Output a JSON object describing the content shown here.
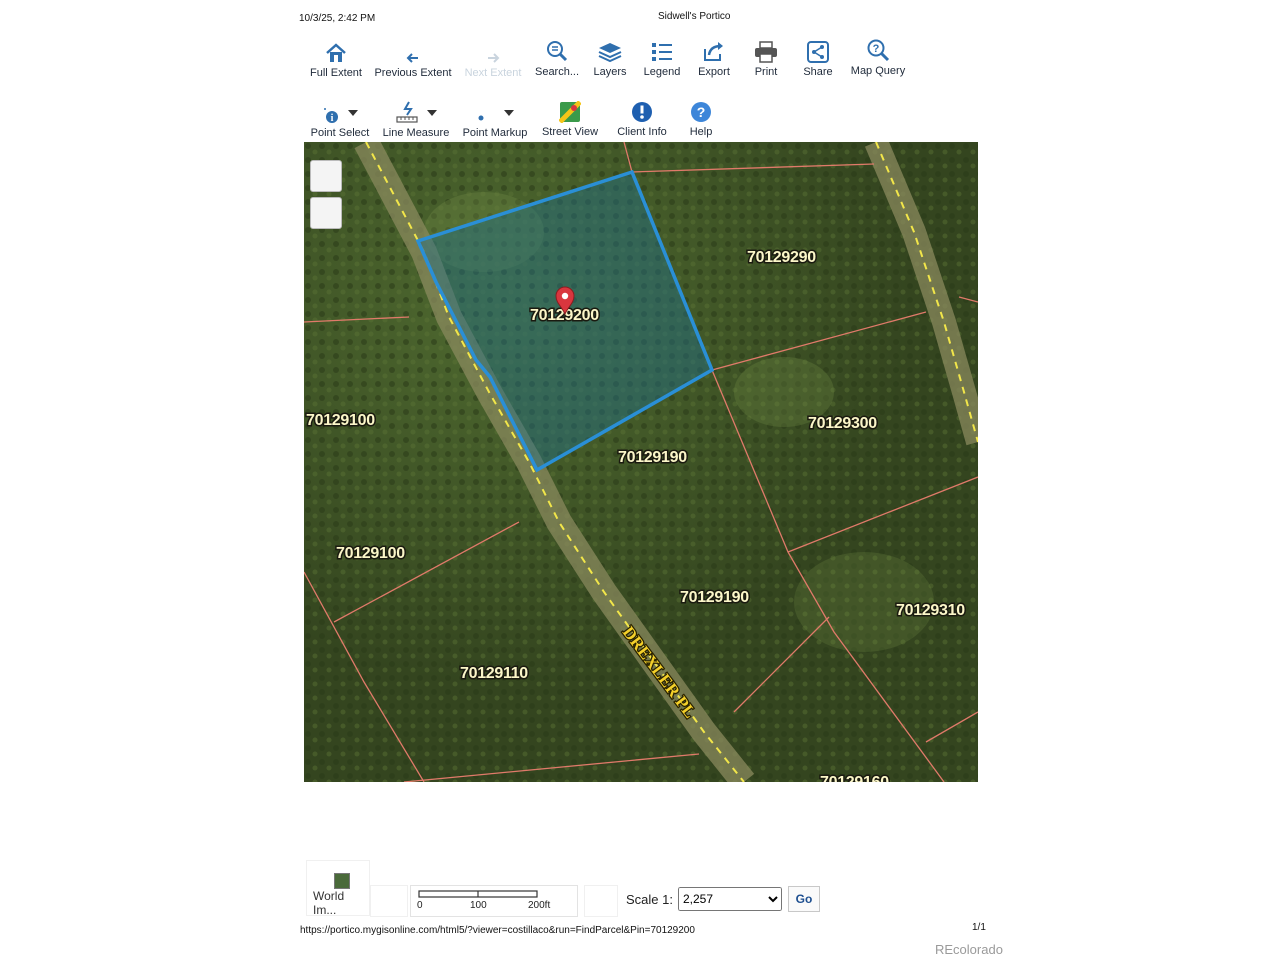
{
  "print_header": {
    "datetime": "10/3/25, 2:42 PM",
    "title": "Sidwell's Portico"
  },
  "toolbar_row1": [
    {
      "label": "Full Extent",
      "icon": "home-icon"
    },
    {
      "label": "Previous Extent",
      "icon": "back-arrow-icon"
    },
    {
      "label": "Next Extent",
      "icon": "forward-arrow-icon",
      "disabled": true
    },
    {
      "label": "Search...",
      "icon": "search-list-icon"
    },
    {
      "label": "Layers",
      "icon": "layers-icon"
    },
    {
      "label": "Legend",
      "icon": "legend-icon"
    },
    {
      "label": "Export",
      "icon": "export-icon"
    },
    {
      "label": "Print",
      "icon": "printer-icon"
    },
    {
      "label": "Share",
      "icon": "share-icon"
    },
    {
      "label": "Map Query",
      "icon": "map-query-icon"
    }
  ],
  "toolbar_row2": [
    {
      "label": "Point Select",
      "icon": "point-select-icon"
    },
    {
      "label": "Line Measure",
      "icon": "line-measure-icon"
    },
    {
      "label": "Point Markup",
      "icon": "point-markup-icon"
    },
    {
      "label": "Street View",
      "icon": "street-view-icon"
    },
    {
      "label": "Client Info",
      "icon": "info-icon"
    },
    {
      "label": "Help",
      "icon": "help-icon"
    }
  ],
  "map": {
    "parcel_labels": [
      "70129200",
      "70129290",
      "70129100",
      "70129300",
      "70129190",
      "70129100",
      "70129190",
      "70129310",
      "70129110",
      "70129160"
    ],
    "road_label": "DREXLER PL",
    "colors": {
      "selection_outline": "#2a8fd6",
      "selection_fill": "#1e6e8a",
      "parcel_lines": "#e07a6a",
      "road_centerline": "#f2e64a",
      "marker": "#d9363e"
    }
  },
  "bottom_bar": {
    "basemap_label": "World Im...",
    "scale_ticks": [
      "0",
      "100",
      "200ft"
    ],
    "scale_label": "Scale 1:",
    "scale_value": "2,257",
    "go_label": "Go"
  },
  "footer": {
    "url": "https://portico.mygisonline.com/html5/?viewer=costillaco&run=FindParcel&Pin=70129200",
    "page": "1/1",
    "watermark": "REcolorado"
  }
}
